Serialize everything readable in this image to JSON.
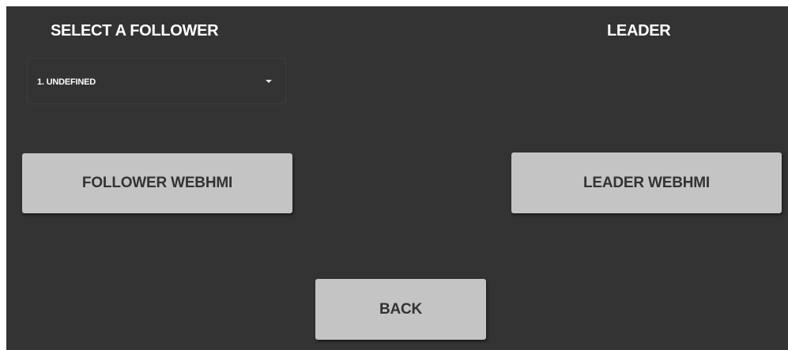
{
  "headings": {
    "follower": "SELECT A FOLLOWER",
    "leader": "LEADER"
  },
  "follower_select": {
    "value": "1. UNDEFINED",
    "icon": "caret-down-icon"
  },
  "buttons": {
    "follower_webhmi": "FOLLOWER WEBHMI",
    "leader_webhmi": "LEADER WEBHMI",
    "back": "BACK"
  },
  "colors": {
    "background": "#333333",
    "button": "#c4c4c4",
    "button_text": "#333333",
    "heading_text": "#ffffff"
  }
}
